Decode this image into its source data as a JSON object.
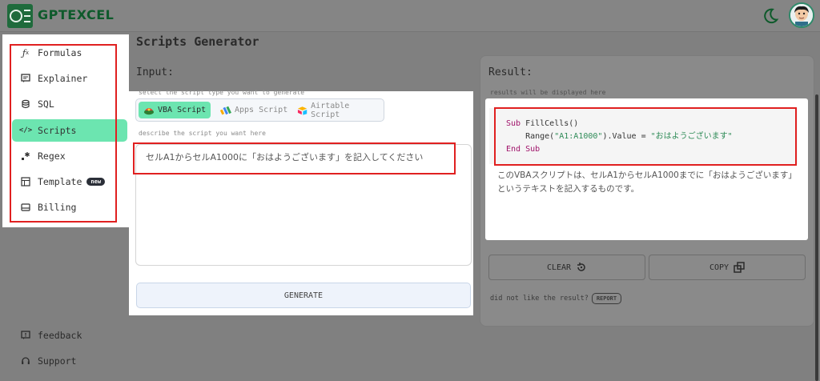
{
  "header": {
    "logo_text": "GPTEXCEL",
    "theme_icon": "moon-icon",
    "avatar_icon": "user-avatar"
  },
  "page": {
    "title": "Scripts Generator"
  },
  "sidebar": {
    "items": [
      {
        "label": "Formulas",
        "icon": "fx-icon"
      },
      {
        "label": "Explainer",
        "icon": "message-icon"
      },
      {
        "label": "SQL",
        "icon": "database-icon"
      },
      {
        "label": "Scripts",
        "icon": "code-icon",
        "active": true
      },
      {
        "label": "Regex",
        "icon": "regex-icon"
      },
      {
        "label": "Template",
        "icon": "table-icon",
        "badge": "new"
      },
      {
        "label": "Billing",
        "icon": "card-icon"
      }
    ],
    "footer": [
      {
        "label": "feedback",
        "icon": "feedback-icon"
      },
      {
        "label": "Support",
        "icon": "headset-icon"
      }
    ]
  },
  "input": {
    "label": "Input:",
    "type_hint": "select the script type you want to generate",
    "types": [
      {
        "label": "VBA Script",
        "icon": "vba-icon",
        "active": true
      },
      {
        "label": "Apps Script",
        "icon": "apps-script-icon"
      },
      {
        "label": "Airtable Script",
        "icon": "airtable-icon"
      }
    ],
    "describe_hint": "describe the script you want here",
    "prompt_value": "セルA1からセルA1000に「おはようございます」を記入してください",
    "generate_label": "GENERATE"
  },
  "result": {
    "label": "Result:",
    "hint": "results will be displayed here",
    "code": {
      "line1_kw": "Sub",
      "line1_rest": " FillCells()",
      "line2_pre": "    Range(",
      "line2_str1": "\"A1:A1000\"",
      "line2_mid": ").Value = ",
      "line2_str2": "\"おはようございます\"",
      "line3_kw": "End Sub"
    },
    "explanation": "このVBAスクリプトは、セルA1からセルA1000までに「おはようございます」というテキストを記入するものです。",
    "clear_label": "CLEAR",
    "copy_label": "COPY",
    "feedback_text": "did not like the result?",
    "report_label": "REPORT"
  },
  "colors": {
    "accent": "#6ce5b0",
    "highlight_red": "#e02020",
    "brand_green": "#1f6b3c"
  }
}
